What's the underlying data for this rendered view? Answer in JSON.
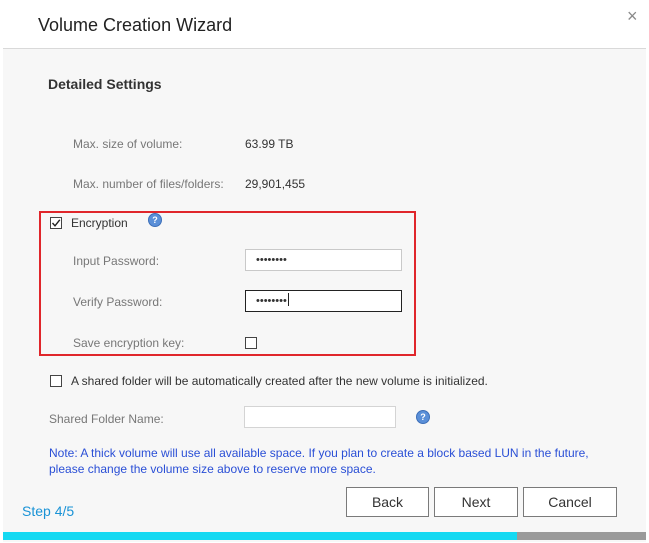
{
  "window": {
    "title": "Volume Creation Wizard",
    "close_glyph": "×"
  },
  "section": {
    "title": "Detailed Settings"
  },
  "info": {
    "max_size_label": "Max. size of volume:",
    "max_size_value": "63.99 TB",
    "max_files_label": "Max. number of files/folders:",
    "max_files_value": "29,901,455"
  },
  "encryption": {
    "label": "Encryption",
    "checked": true,
    "help_glyph": "?",
    "input_password_label": "Input Password:",
    "input_password_value": "••••••••",
    "verify_password_label": "Verify Password:",
    "verify_password_value": "••••••••",
    "save_key_label": "Save encryption key:",
    "save_key_checked": false
  },
  "shared_folder": {
    "label": "A shared folder will be automatically created after the new volume is initialized.",
    "checked": false,
    "name_label": "Shared Folder Name:",
    "name_value": "",
    "help_glyph": "?"
  },
  "note": "Note: A thick volume will use all available space. If you plan to create a block based LUN in the future, please change the volume size above to reserve more space.",
  "buttons": {
    "back": "Back",
    "next": "Next",
    "cancel": "Cancel"
  },
  "step": {
    "label": "Step 4/5",
    "progress": 0.8
  },
  "colors": {
    "accent": "#14d9f2",
    "step_text": "#1a93d6",
    "note_text": "#2a4fd6",
    "highlight_border": "#e0262b",
    "help_icon": "#5a8fd8"
  }
}
